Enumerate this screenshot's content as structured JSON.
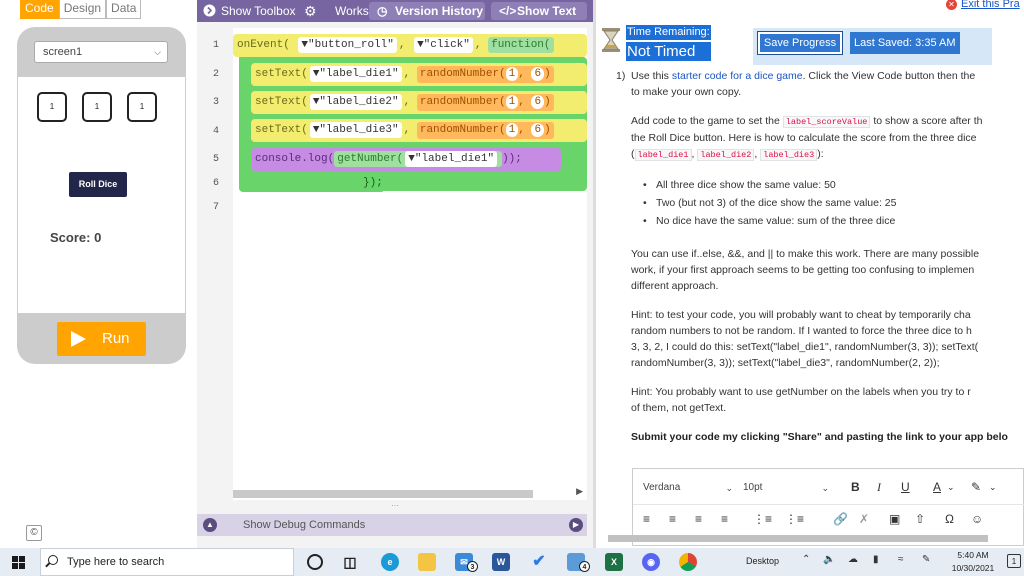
{
  "mode_tabs": [
    "Code",
    "Design",
    "Data"
  ],
  "app_preview": {
    "screen_select": "screen1",
    "dice": [
      "1",
      "1",
      "1"
    ],
    "roll_button": "Roll Dice",
    "score_text": "Score: 0",
    "run_button": "Run"
  },
  "workspace": {
    "show_toolbox": "Show Toolbox",
    "workspace_label": "Works",
    "version_history": "Version History",
    "show_text": "Show Text",
    "line_numbers": [
      "1",
      "2",
      "3",
      "4",
      "5",
      "6",
      "7"
    ],
    "debug_commands": "Show Debug Commands",
    "code": {
      "line1": {
        "call": "onEvent(",
        "arg1": "\"button_roll\"",
        "arg2": "\"click\"",
        "fn": "function("
      },
      "line2": {
        "call": "setText(",
        "arg": "\"label_die1\"",
        "rand": "randomNumber(",
        "a": "1",
        "b": "6",
        "close": ")"
      },
      "line3": {
        "call": "setText(",
        "arg": "\"label_die2\"",
        "rand": "randomNumber(",
        "a": "1",
        "b": "6",
        "close": ")"
      },
      "line4": {
        "call": "setText(",
        "arg": "\"label_die3\"",
        "rand": "randomNumber(",
        "a": "1",
        "b": "6",
        "close": ")"
      },
      "line5": {
        "call": "console.log(",
        "get": "getNumber(",
        "arg": "\"label_die1\"",
        "close": "));"
      },
      "line6": {
        "close": "});"
      }
    }
  },
  "instructions": {
    "exit_link": "Exit this Pra",
    "time_remaining_label": "Time Remaining:",
    "time_value": "Not Timed",
    "save_progress": "Save Progress",
    "last_saved": "Last Saved: 3:35 AM",
    "question_number": "1)",
    "para1_pre": "Use this ",
    "para1_link": "starter code for a dice game",
    "para1_post": ". Click the View Code button then the",
    "para1_line2": "to make your own copy.",
    "para2_pre": "Add code to the game to set the ",
    "para2_code": "label_scoreValue",
    "para2_post": " to show a score after th",
    "para2_line2": "the Roll Dice button. Here is how to calculate the score from the three dice",
    "para2_paren_open": "(",
    "code_die1": "label_die1",
    "code_die2": "label_die2",
    "code_die3": "label_die3",
    "para2_paren_close": "):",
    "bullets": [
      "All three dice show the same value: 50",
      "Two (but not 3) of the dice show the same value: 25",
      "No dice have the same value: sum of the three dice"
    ],
    "para3_lines": [
      "You can use if..else, &&, and || to make this work. There are many possible",
      "work, if your first approach seems to be getting too confusing to implemen",
      "different approach."
    ],
    "para4_lines": [
      "Hint: to test your code, you will probably want to cheat by temporarily cha",
      "random numbers to not be random. If I wanted to force the three dice to h",
      "3, 3, 2, I could do this: setText(\"label_die1\", randomNumber(3, 3)); setText(",
      "randomNumber(3, 3)); setText(\"label_die3\", randomNumber(2, 2));"
    ],
    "para5_lines": [
      "Hint: You probably want to use getNumber on the labels when you try to r",
      "of them, not getText."
    ],
    "para6": "Submit your code my clicking \"Share\" and pasting the link to your app belo",
    "editor_font": "Verdana",
    "editor_size": "10pt"
  },
  "taskbar": {
    "search_placeholder": "Type here to search",
    "desktop_label": "Desktop",
    "time": "5:40 AM",
    "date": "10/30/2021",
    "mail_badge": "3",
    "files_badge": "4",
    "notif_badge": "1"
  },
  "colors": {
    "accent_orange": "#ffa400",
    "header_purple": "#7665a0",
    "save_blue": "#2f77d1",
    "roll_button_navy": "#21264a"
  }
}
